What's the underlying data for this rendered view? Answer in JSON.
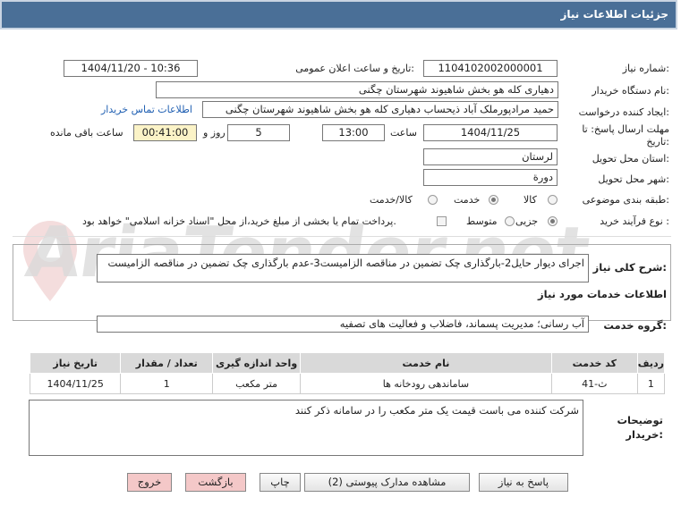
{
  "header": {
    "title": "جزئیات اطلاعات نیاز"
  },
  "form": {
    "need_number_label": "شماره نیاز:",
    "need_number_value": "1104102002000001",
    "announce_label": "تاریخ و ساعت اعلان عمومی:",
    "announce_value": "1404/11/20 - 10:36",
    "buyer_org_label": "نام دستگاه خریدار:",
    "buyer_org_value": "دهیاری کله هو بخش شاهیوند شهرستان چگنی",
    "requester_label": "ایجاد کننده درخواست:",
    "requester_value": "حمید مرادپورملک آباد ذیحساب دهیاری کله هو بخش شاهیوند شهرستان چگنی",
    "contact_link": "اطلاعات تماس خریدار",
    "deadline_label": "مهلت ارسال پاسخ: تا تاریخ:",
    "deadline_date": "1404/11/25",
    "time_label": "ساعت",
    "deadline_time": "13:00",
    "days_value": "5",
    "days_label": "روز و",
    "remaining_value": "00:41:00",
    "remaining_label": "ساعت باقی مانده",
    "province_label": "استان محل تحویل:",
    "province_value": "لرستان",
    "city_label": "شهر محل تحویل:",
    "city_value": "دورة",
    "category_label": "طبقه بندی موضوعی:",
    "category_options": [
      "کالا",
      "خدمت",
      "کالا/خدمت"
    ],
    "category_selected": "خدمت",
    "process_label": "نوع فرآیند خرید :",
    "process_options": [
      "جزیی",
      "متوسط"
    ],
    "process_selected": "جزیی",
    "process_note": "پرداخت تمام یا بخشی از مبلغ خرید،از محل \"اسناد خزانه اسلامی\" خواهد بود."
  },
  "description": {
    "label": "شرح کلی نیاز:",
    "value": "اجرای دیوار حایل2-بارگذاری چک تضمین در مناقصه الزامیست3-عدم بارگذاری چک تضمین در مناقصه الزامیست"
  },
  "services": {
    "section_title": "اطلاعات خدمات مورد نیاز",
    "group_label": "گروه خدمت:",
    "group_value": "آب رسانی؛ مدیریت پسماند، فاضلاب و فعالیت های تصفیه",
    "columns": [
      "ردیف",
      "کد خدمت",
      "نام خدمت",
      "واحد اندازه گیری",
      "تعداد / مقدار",
      "تاریخ نیاز"
    ],
    "rows": [
      {
        "row": "1",
        "code": "ث-41",
        "name": "ساماندهی رودخانه ها",
        "unit": "متر مکعب",
        "qty": "1",
        "date": "1404/11/25"
      }
    ]
  },
  "buyer_notes": {
    "label": "توضیحات خریدار:",
    "value": "شرکت کننده می باست قیمت یک متر مکعب را در سامانه ذکر کنند"
  },
  "buttons": {
    "reply": "پاسخ به نیاز",
    "attachments": "مشاهده مدارک پیوستی (2)",
    "print": "چاپ",
    "back": "بازگشت",
    "exit": "خروج"
  },
  "watermark": {
    "text": "AriaTender.net"
  },
  "colors": {
    "header_bg": "#4a6f97",
    "link": "#1f5fb2",
    "remaining_bg": "#fbf3c7",
    "exit_button": "#f4c8c8",
    "back_button": "#f4c8c8"
  }
}
